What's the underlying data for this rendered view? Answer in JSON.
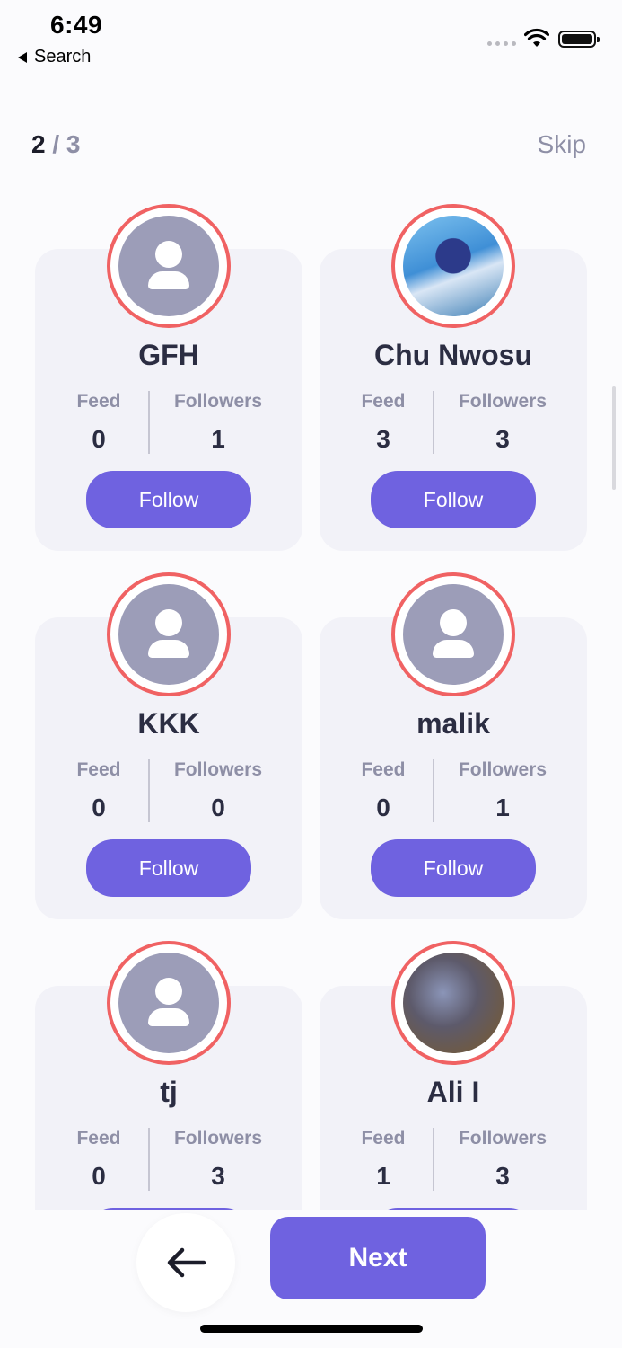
{
  "status_bar": {
    "time": "6:49",
    "back_label": "Search"
  },
  "header": {
    "current_step": "2",
    "separator": " / ",
    "total_steps": "3",
    "skip_label": "Skip"
  },
  "stat_labels": {
    "feed": "Feed",
    "followers": "Followers"
  },
  "follow_label": "Follow",
  "users": [
    {
      "name": "GFH",
      "feed": "0",
      "followers": "1",
      "avatar": "placeholder"
    },
    {
      "name": "Chu Nwosu",
      "feed": "3",
      "followers": "3",
      "avatar": "photo"
    },
    {
      "name": "KKK",
      "feed": "0",
      "followers": "0",
      "avatar": "placeholder"
    },
    {
      "name": "malik",
      "feed": "0",
      "followers": "1",
      "avatar": "placeholder"
    },
    {
      "name": "tj",
      "feed": "0",
      "followers": "3",
      "avatar": "placeholder"
    },
    {
      "name": "Ali I",
      "feed": "1",
      "followers": "3",
      "avatar": "photo"
    }
  ],
  "footer": {
    "next_label": "Next",
    "back_icon": "arrow-left-icon"
  },
  "colors": {
    "accent": "#6f62e0",
    "ring": "#f06263",
    "card": "#f2f2f8"
  }
}
